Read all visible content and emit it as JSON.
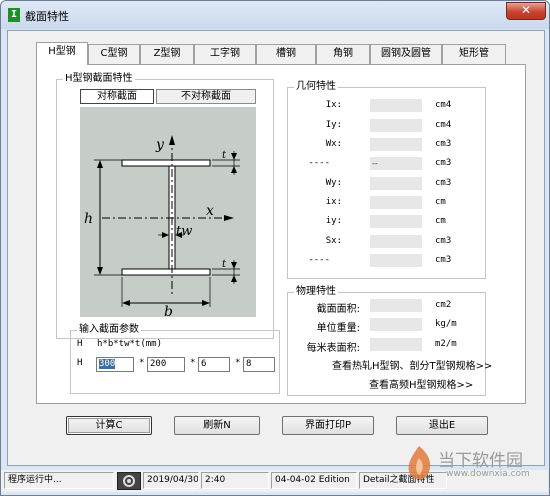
{
  "window": {
    "title": "截面特性",
    "app_icon": "I",
    "close_glyph": "✕"
  },
  "tabs": [
    {
      "label": "H型钢",
      "active": true
    },
    {
      "label": "C型钢"
    },
    {
      "label": "Z型钢"
    },
    {
      "label": "工字钢"
    },
    {
      "label": "槽钢"
    },
    {
      "label": "角钢"
    },
    {
      "label": "圆钢及圆管"
    },
    {
      "label": "矩形管"
    }
  ],
  "section_group": {
    "title": "H型钢截面特性",
    "symmetric_label": "对称截面",
    "asymmetric_label": "不对称截面",
    "selected": "symmetric"
  },
  "diagram": {
    "labels": {
      "y": "y",
      "x": "x",
      "h": "h",
      "b": "b",
      "tw": "tw",
      "t_top": "t",
      "t_bottom": "t"
    },
    "colors": {
      "background": "#c6cdc6",
      "flange": "#ffffff",
      "line": "#000000"
    }
  },
  "geometry": {
    "title": "几何特性",
    "rows": [
      {
        "label": "Ix:",
        "value": "",
        "unit": "cm4"
      },
      {
        "label": "Iy:",
        "value": "",
        "unit": "cm4"
      },
      {
        "label": "Wx:",
        "value": "",
        "unit": "cm3"
      },
      {
        "label": "----",
        "value": "--",
        "unit": "cm3"
      },
      {
        "label": "Wy:",
        "value": "",
        "unit": "cm3"
      },
      {
        "label": "ix:",
        "value": "",
        "unit": "cm"
      },
      {
        "label": "iy:",
        "value": "",
        "unit": "cm"
      },
      {
        "label": "Sx:",
        "value": "",
        "unit": "cm3"
      },
      {
        "label": "----",
        "value": "",
        "unit": "cm3"
      }
    ]
  },
  "physical": {
    "title": "物理特性",
    "rows": [
      {
        "label": "截面面积:",
        "value": "",
        "unit": "cm2"
      },
      {
        "label": "单位重量:",
        "value": "",
        "unit": "kg/m"
      },
      {
        "label": "每米表面积:",
        "value": "",
        "unit": "m2/m"
      }
    ],
    "link1": "查看热轧H型钢、剖分T型钢规格>>",
    "link2": "查看高频H型钢规格>>"
  },
  "input_params": {
    "title": "输入截面参数",
    "row1_prefix": "H",
    "row1_format": "h*b*tw*t(mm)",
    "row2_prefix": "H",
    "separator": "*",
    "h": "300",
    "b": "200",
    "tw": "6",
    "t": "8"
  },
  "buttons": {
    "calc": "计算C",
    "refresh": "刷新N",
    "print": "界面打印P",
    "exit": "退出E"
  },
  "statusbar": {
    "status": "程序运行中...",
    "date": "2019/04/30",
    "time": "2:40",
    "edition": "04-04-02 Edition",
    "detail": "Detail之截面特性"
  },
  "watermark": {
    "site_name": "当下软件园",
    "url": "www.downxia.com",
    "colors": {
      "logo": "#e07a3c",
      "text": "#9a9a9a"
    }
  }
}
